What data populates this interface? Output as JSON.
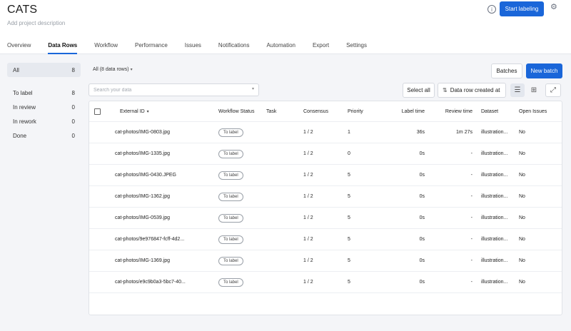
{
  "project": {
    "title": "CATS",
    "description": "Add project description"
  },
  "header": {
    "help_glyph": "i",
    "start_labeling": "Start labeling"
  },
  "tabs": [
    {
      "label": "Overview"
    },
    {
      "label": "Data Rows"
    },
    {
      "label": "Workflow"
    },
    {
      "label": "Performance"
    },
    {
      "label": "Issues"
    },
    {
      "label": "Notifications"
    },
    {
      "label": "Automation"
    },
    {
      "label": "Export"
    },
    {
      "label": "Settings"
    }
  ],
  "active_tab": "Data Rows",
  "status_filters": [
    {
      "label": "All",
      "count": "8"
    },
    {
      "label": "To label",
      "count": "8"
    },
    {
      "label": "In review",
      "count": "0"
    },
    {
      "label": "In rework",
      "count": "0"
    },
    {
      "label": "Done",
      "count": "0"
    }
  ],
  "toolbar": {
    "scope_label": "All (8 data rows)",
    "batches": "Batches",
    "new_batch": "New batch",
    "search_placeholder": "Search your data",
    "select_all": "Select all",
    "sort_label": "Data row created at"
  },
  "table": {
    "columns": {
      "external_id": "External ID",
      "workflow_status": "Workflow Status",
      "task": "Task",
      "consensus": "Consensus",
      "priority": "Priority",
      "label_time": "Label time",
      "review_time": "Review time",
      "dataset": "Dataset",
      "open_issues": "Open Issues"
    },
    "rows": [
      {
        "external_id": "cat-photos/IMG-0803.jpg",
        "status": "To label",
        "task": "",
        "consensus": "1 / 2",
        "priority": "1",
        "label_time": "36s",
        "review_time": "1m 27s",
        "dataset": "illustration...",
        "open_issues": "No"
      },
      {
        "external_id": "cat-photos/IMG-1335.jpg",
        "status": "To label",
        "task": "",
        "consensus": "1 / 2",
        "priority": "0",
        "label_time": "0s",
        "review_time": "-",
        "dataset": "illustration...",
        "open_issues": "No"
      },
      {
        "external_id": "cat-photos/IMG-0430.JPEG",
        "status": "To label",
        "task": "",
        "consensus": "1 / 2",
        "priority": "5",
        "label_time": "0s",
        "review_time": "-",
        "dataset": "illustration...",
        "open_issues": "No"
      },
      {
        "external_id": "cat-photos/IMG-1362.jpg",
        "status": "To label",
        "task": "",
        "consensus": "1 / 2",
        "priority": "5",
        "label_time": "0s",
        "review_time": "-",
        "dataset": "illustration...",
        "open_issues": "No"
      },
      {
        "external_id": "cat-photos/IMG-0539.jpg",
        "status": "To label",
        "task": "",
        "consensus": "1 / 2",
        "priority": "5",
        "label_time": "0s",
        "review_time": "-",
        "dataset": "illustration...",
        "open_issues": "No"
      },
      {
        "external_id": "cat-photos/9e976847-fcff-4d2...",
        "status": "To label",
        "task": "",
        "consensus": "1 / 2",
        "priority": "5",
        "label_time": "0s",
        "review_time": "-",
        "dataset": "illustration...",
        "open_issues": "No"
      },
      {
        "external_id": "cat-photos/IMG-1369.jpg",
        "status": "To label",
        "task": "",
        "consensus": "1 / 2",
        "priority": "5",
        "label_time": "0s",
        "review_time": "-",
        "dataset": "illustration...",
        "open_issues": "No"
      },
      {
        "external_id": "cat-photos/e9c9b0a3-5bc7-40...",
        "status": "To label",
        "task": "",
        "consensus": "1 / 2",
        "priority": "5",
        "label_time": "0s",
        "review_time": "-",
        "dataset": "illustration...",
        "open_issues": "No"
      }
    ]
  },
  "colors": {
    "primary": "#1a66d9",
    "active_filter_bg": "#e6e9ef"
  }
}
